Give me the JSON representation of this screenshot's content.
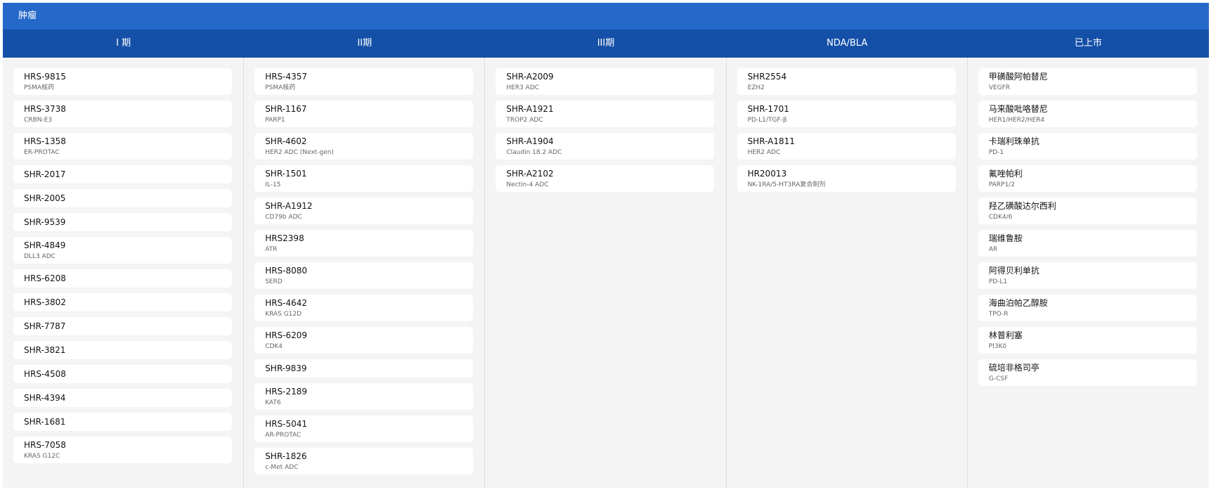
{
  "title": "肿瘤",
  "phases": [
    {
      "name": "I 期",
      "drugs": [
        {
          "name": "HRS-9815",
          "target": "PSMA核药"
        },
        {
          "name": "HRS-3738",
          "target": "CRBN-E3"
        },
        {
          "name": "HRS-1358",
          "target": "ER-PROTAC"
        },
        {
          "name": "SHR-2017",
          "target": ""
        },
        {
          "name": "SHR-2005",
          "target": ""
        },
        {
          "name": "SHR-9539",
          "target": ""
        },
        {
          "name": "SHR-4849",
          "target": "DLL3 ADC"
        },
        {
          "name": "HRS-6208",
          "target": ""
        },
        {
          "name": "HRS-3802",
          "target": ""
        },
        {
          "name": "SHR-7787",
          "target": ""
        },
        {
          "name": "SHR-3821",
          "target": ""
        },
        {
          "name": "HRS-4508",
          "target": ""
        },
        {
          "name": "SHR-4394",
          "target": ""
        },
        {
          "name": "SHR-1681",
          "target": ""
        },
        {
          "name": "HRS-7058",
          "target": "KRAS G12C"
        }
      ]
    },
    {
      "name": "II期",
      "drugs": [
        {
          "name": "HRS-4357",
          "target": "PSMA核药"
        },
        {
          "name": "SHR-1167",
          "target": "PARP1"
        },
        {
          "name": "SHR-4602",
          "target": "HER2 ADC (Next-gen)"
        },
        {
          "name": "SHR-1501",
          "target": "IL-15"
        },
        {
          "name": "SHR-A1912",
          "target": "CD79b ADC"
        },
        {
          "name": "HRS2398",
          "target": "ATR"
        },
        {
          "name": "HRS-8080",
          "target": "SERD"
        },
        {
          "name": "HRS-4642",
          "target": "KRAS G12D"
        },
        {
          "name": "HRS-6209",
          "target": "CDK4"
        },
        {
          "name": "SHR-9839",
          "target": ""
        },
        {
          "name": "HRS-2189",
          "target": "KAT6"
        },
        {
          "name": "HRS-5041",
          "target": "AR-PROTAC"
        },
        {
          "name": "SHR-1826",
          "target": "c-Met ADC"
        }
      ]
    },
    {
      "name": "III期",
      "drugs": [
        {
          "name": "SHR-A2009",
          "target": "HER3 ADC"
        },
        {
          "name": "SHR-A1921",
          "target": "TROP2 ADC"
        },
        {
          "name": "SHR-A1904",
          "target": "Claudin 18.2 ADC"
        },
        {
          "name": "SHR-A2102",
          "target": "Nectin-4 ADC"
        }
      ]
    },
    {
      "name": "NDA/BLA",
      "drugs": [
        {
          "name": "SHR2554",
          "target": "EZH2"
        },
        {
          "name": "SHR-1701",
          "target": "PD-L1/TGF-β"
        },
        {
          "name": "SHR-A1811",
          "target": "HER2 ADC"
        },
        {
          "name": "HR20013",
          "target": "NK-1RA/5-HT3RA复合制剂"
        }
      ]
    },
    {
      "name": "已上市",
      "drugs": [
        {
          "name": "甲磺酸阿帕替尼",
          "target": "VEGFR"
        },
        {
          "name": "马来酸吡咯替尼",
          "target": "HER1/HER2/HER4"
        },
        {
          "name": "卡瑞利珠单抗",
          "target": "PD-1"
        },
        {
          "name": "氟唑帕利",
          "target": "PARP1/2"
        },
        {
          "name": "羟乙磺酸达尔西利",
          "target": "CDK4/6"
        },
        {
          "name": "瑞维鲁胺",
          "target": "AR"
        },
        {
          "name": "阿得贝利单抗",
          "target": "PD-L1"
        },
        {
          "name": "海曲泊帕乙醇胺",
          "target": "TPO-R"
        },
        {
          "name": "林普利塞",
          "target": "PI3Kδ"
        },
        {
          "name": "硫培非格司亭",
          "target": "G-CSF"
        }
      ]
    }
  ]
}
